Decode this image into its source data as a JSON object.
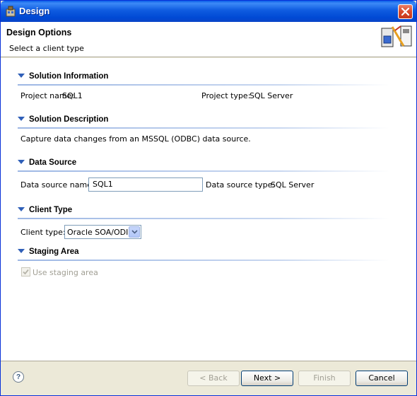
{
  "window": {
    "title": "Design"
  },
  "header": {
    "title": "Design Options",
    "subtitle": "Select a client type"
  },
  "sections": {
    "solution_information": {
      "heading": "Solution Information",
      "project_name_label": "Project name:",
      "project_name_value": "SQL1",
      "project_type_label": "Project type:",
      "project_type_value": "SQL Server"
    },
    "solution_description": {
      "heading": "Solution Description",
      "text": "Capture data changes from an MSSQL (ODBC) data source."
    },
    "data_source": {
      "heading": "Data Source",
      "name_label": "Data source name:",
      "name_value": "SQL1",
      "type_label": "Data source type:",
      "type_value": "SQL Server"
    },
    "client_type": {
      "heading": "Client Type",
      "label": "Client type:",
      "selected": "Oracle SOA/ODI"
    },
    "staging_area": {
      "heading": "Staging Area",
      "checkbox_label": "Use staging area",
      "checked": true,
      "enabled": false
    }
  },
  "buttons": {
    "back": "< Back",
    "next": "Next >",
    "finish": "Finish",
    "cancel": "Cancel"
  },
  "help": {
    "glyph": "?"
  },
  "icons": [
    "app-icon",
    "close-icon",
    "wizard-image",
    "section-collapse-icon",
    "chevron-down-icon",
    "help-icon",
    "checkmark-icon"
  ]
}
